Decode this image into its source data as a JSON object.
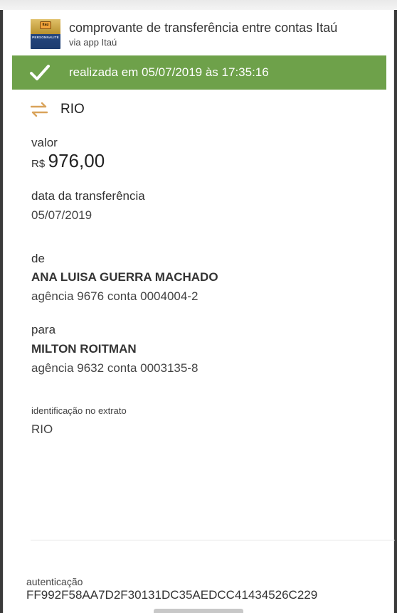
{
  "header": {
    "title": "comprovante de transferência entre contas Itaú",
    "subtitle": "via app Itaú",
    "logo_mark": "Itaú",
    "logo_text": "PERSONNALITÉ"
  },
  "status": {
    "text": "realizada em 05/07/2019 às 17:35:16",
    "color": "#6ea14a",
    "icon": "check-icon"
  },
  "transfer": {
    "title": "RIO",
    "icon": "transfer-arrows-icon",
    "icon_color": "#d9a35a"
  },
  "valor": {
    "label": "valor",
    "currency": "R$",
    "amount": "976,00"
  },
  "data_transferencia": {
    "label": "data da transferência",
    "value": "05/07/2019"
  },
  "de": {
    "label": "de",
    "name": "ANA LUISA GUERRA MACHADO",
    "account": "agência 9676 conta 0004004-2"
  },
  "para": {
    "label": "para",
    "name": "MILTON ROITMAN",
    "account": "agência 9632 conta 0003135-8"
  },
  "identificacao": {
    "label": "identificação no extrato",
    "value": "RIO"
  },
  "autenticacao": {
    "label": "autenticação",
    "code": "FF992F58AA7D2F30131DC35AEDCC41434526C229"
  }
}
